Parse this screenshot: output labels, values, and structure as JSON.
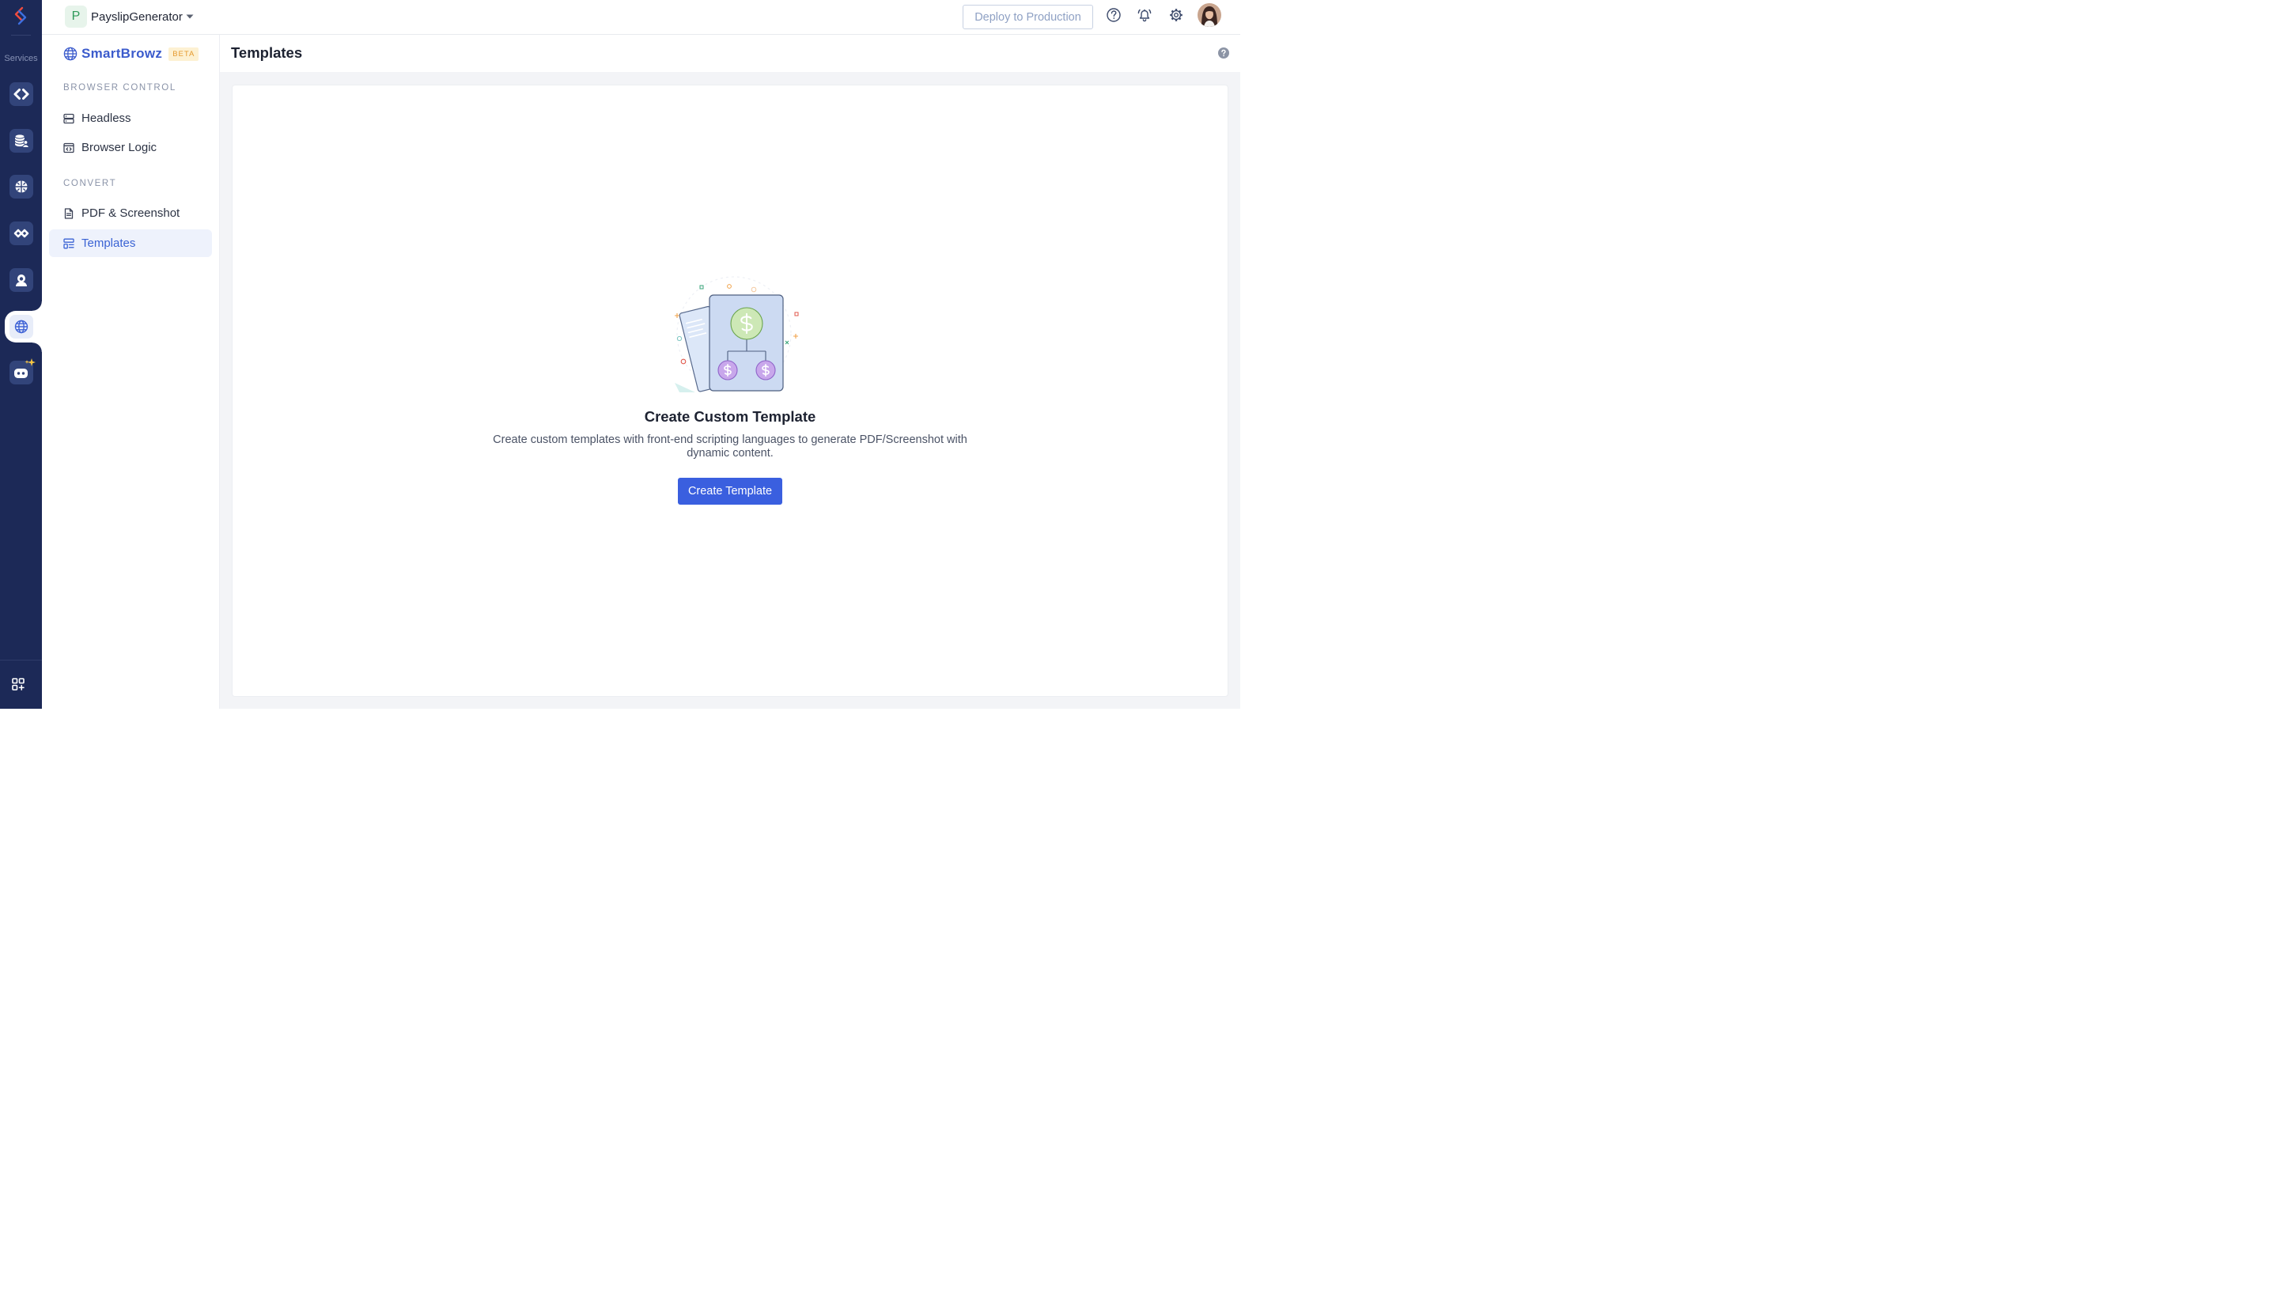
{
  "rail": {
    "logo_icon": "catalyst-logo-icon",
    "section_label": "Services",
    "services": [
      {
        "icon": "code-brackets-icon",
        "active": false
      },
      {
        "icon": "database-user-icon",
        "active": false
      },
      {
        "icon": "brain-icon",
        "active": false
      },
      {
        "icon": "integration-icon",
        "active": false
      },
      {
        "icon": "user-bust-icon",
        "active": false
      },
      {
        "icon": "globe-icon",
        "active": true
      },
      {
        "icon": "robot-sparkle-icon",
        "active": false
      }
    ],
    "apps_icon": "apps-grid-icon"
  },
  "header": {
    "project": {
      "initial": "P",
      "name": "PayslipGenerator",
      "dropdown_icon": "caret-down-icon"
    },
    "deploy_label": "Deploy to Production",
    "icons": [
      "help-icon",
      "bell-icon",
      "gear-icon"
    ],
    "avatar": "user-avatar"
  },
  "sidebar": {
    "brand": {
      "icon": "globe-icon",
      "name": "SmartBrowz",
      "badge": "BETA"
    },
    "sections": [
      {
        "title": "BROWSER CONTROL",
        "items": [
          {
            "label": "Headless",
            "icon": "server-icon",
            "active": false
          },
          {
            "label": "Browser Logic",
            "icon": "browser-code-icon",
            "active": false
          }
        ]
      },
      {
        "title": "CONVERT",
        "items": [
          {
            "label": "PDF & Screenshot",
            "icon": "document-icon",
            "active": false
          },
          {
            "label": "Templates",
            "icon": "template-layout-icon",
            "active": true
          }
        ]
      }
    ]
  },
  "main": {
    "title": "Templates",
    "help_icon": "help-circle-icon",
    "empty_state": {
      "illustration": "payslip-template-illustration",
      "title": "Create Custom Template",
      "description": "Create custom templates with front-end scripting languages to generate PDF/Screenshot with dynamic content.",
      "button_label": "Create Template"
    }
  },
  "colors": {
    "rail_background": "#1c2957",
    "rail_tile": "#32447a",
    "accent": "#3a5fdf",
    "brand": "#3b5bcc",
    "active_nav_background": "#eef2fc",
    "active_nav_text": "#3a63d4",
    "badge_background": "#fdf1d2",
    "badge_text": "#e59a2f",
    "project_avatar_background": "#e7f4eb",
    "project_avatar_text": "#2f9a5a"
  }
}
